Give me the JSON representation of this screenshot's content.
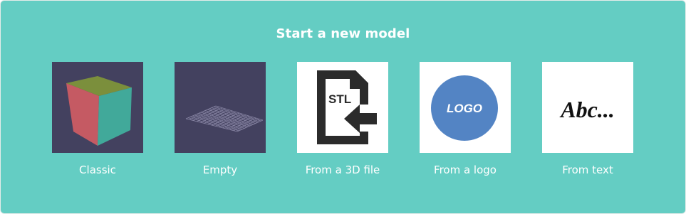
{
  "title": "Start a new model",
  "options": [
    {
      "id": "classic",
      "label": "Classic",
      "icon": "cube-icon"
    },
    {
      "id": "empty",
      "label": "Empty",
      "icon": "grid-plane-icon"
    },
    {
      "id": "from-3d-file",
      "label": "From a 3D file",
      "icon": "stl-file-import-icon",
      "badge": "STL"
    },
    {
      "id": "from-logo",
      "label": "From a logo",
      "icon": "logo-badge-icon",
      "badge": "LOGO"
    },
    {
      "id": "from-text",
      "label": "From text",
      "icon": "script-text-icon",
      "badge": "Abc..."
    }
  ],
  "colors": {
    "panel_bg": "#64cdc3",
    "thumb_dark": "#43415f",
    "logo_circle": "#5384c4"
  }
}
